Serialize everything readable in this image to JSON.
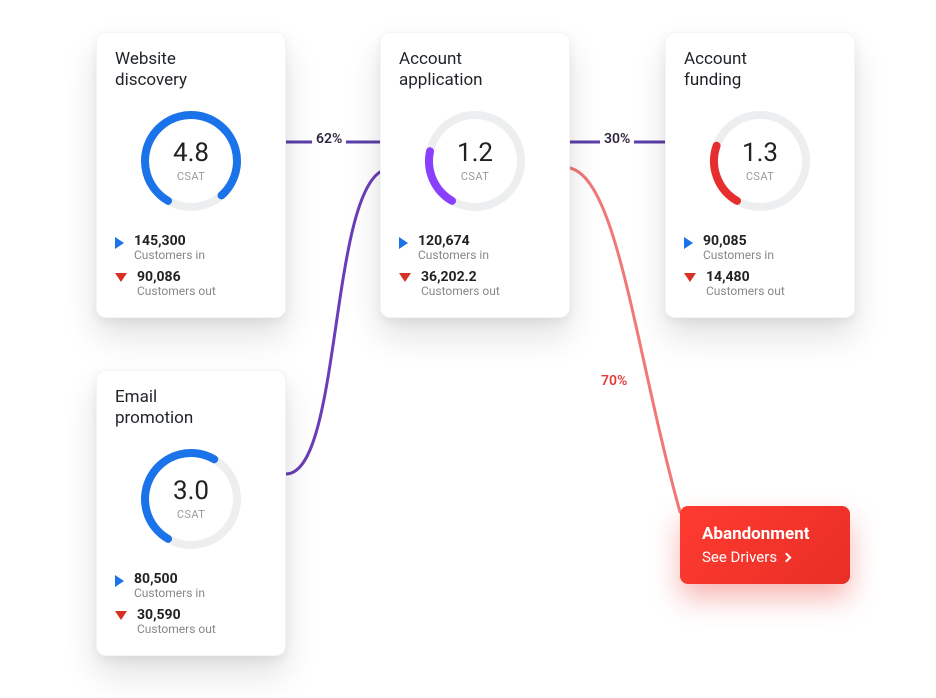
{
  "flow": {
    "cards": {
      "website": {
        "title": "Website\ndiscovery",
        "csat": "4.8",
        "csat_label": "CSAT",
        "in_value": "145,300",
        "in_label": "Customers in",
        "out_value": "90,086",
        "out_label": "Customers out",
        "ring_color": "#1a73e8",
        "ring_fraction": 0.8
      },
      "email": {
        "title": "Email\npromotion",
        "csat": "3.0",
        "csat_label": "CSAT",
        "in_value": "80,500",
        "in_label": "Customers in",
        "out_value": "30,590",
        "out_label": "Customers out",
        "ring_color": "#1a73e8",
        "ring_fraction": 0.5
      },
      "application": {
        "title": "Account\napplication",
        "csat": "1.2",
        "csat_label": "CSAT",
        "in_value": "120,674",
        "in_label": "Customers in",
        "out_value": "36,202.2",
        "out_label": "Customers out",
        "ring_color": "#8a3ffc",
        "ring_fraction": 0.2
      },
      "funding": {
        "title": "Account\nfunding",
        "csat": "1.3",
        "csat_label": "CSAT",
        "in_value": "90,085",
        "in_label": "Customers in",
        "out_value": "14,480",
        "out_label": "Customers out",
        "ring_color": "#e62e2e",
        "ring_fraction": 0.22
      }
    },
    "connections": {
      "to_application": "62%",
      "to_funding": "30%",
      "to_abandon": "70%"
    },
    "callout": {
      "title": "Abandonment",
      "cta": "See Drivers"
    }
  },
  "chart_data": [
    {
      "type": "pie",
      "title": "Website discovery CSAT",
      "values": [
        4.8,
        1.2
      ],
      "max": 6,
      "color": "#1a73e8"
    },
    {
      "type": "pie",
      "title": "Email promotion CSAT",
      "values": [
        3.0,
        3.0
      ],
      "max": 6,
      "color": "#1a73e8"
    },
    {
      "type": "pie",
      "title": "Account application CSAT",
      "values": [
        1.2,
        4.8
      ],
      "max": 6,
      "color": "#8a3ffc"
    },
    {
      "type": "pie",
      "title": "Account funding CSAT",
      "values": [
        1.3,
        4.7
      ],
      "max": 6,
      "color": "#e62e2e"
    }
  ]
}
